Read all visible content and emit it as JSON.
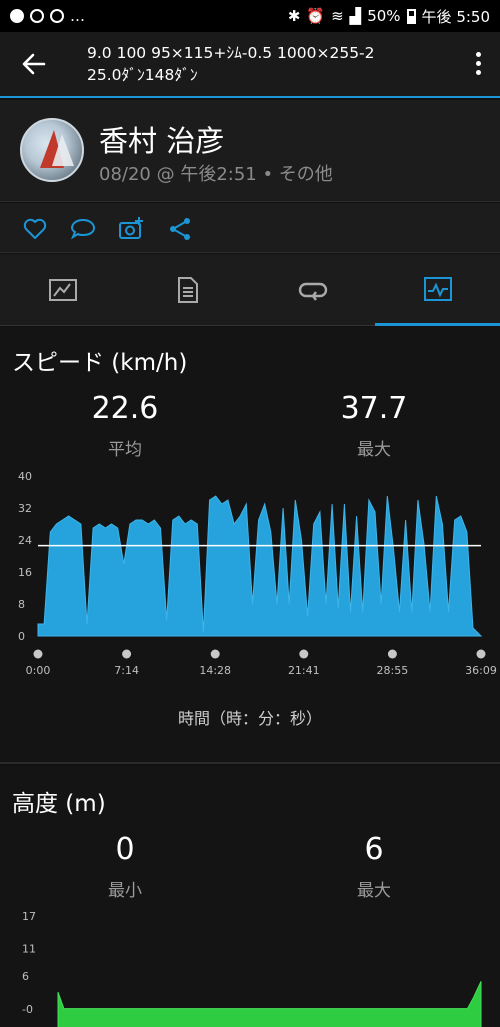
{
  "status_bar": {
    "left_text": "…",
    "battery": "50%",
    "time": "午後 5:50"
  },
  "appbar": {
    "title_line1": "9.0 100 95×115+ｼﾑ-0.5 1000×255-2",
    "title_line2": "25.0ﾀﾞﾝ148ﾀﾞﾝ"
  },
  "profile": {
    "name": "香村 治彦",
    "meta": "08/20 @ 午後2:51 • その他"
  },
  "actions": [
    "like-icon",
    "comment-icon",
    "add-photo-icon",
    "share-icon"
  ],
  "tabs": [
    {
      "name": "overview",
      "icon": "map-summary-icon"
    },
    {
      "name": "details",
      "icon": "document-icon"
    },
    {
      "name": "laps",
      "icon": "laps-icon"
    },
    {
      "name": "charts",
      "icon": "chart-icon",
      "active": true
    }
  ],
  "colors": {
    "accent": "#1b95d6",
    "speed_fill": "#26a3dc",
    "altitude_fill": "#2ecc40"
  },
  "speed": {
    "title": "スピード (km/h)",
    "avg_value": "22.6",
    "avg_label": "平均",
    "max_value": "37.7",
    "max_label": "最大",
    "x_axis_title": "時間（時：分：秒）"
  },
  "altitude": {
    "title": "高度 (m)",
    "min_value": "0",
    "min_label": "最小",
    "max_value": "6",
    "max_label": "最大"
  },
  "chart_data": [
    {
      "type": "area",
      "name": "speed",
      "ylim": [
        0,
        40
      ],
      "yticks": [
        "40",
        "32",
        "24",
        "16",
        "8",
        "0"
      ],
      "xticks": [
        "0:00",
        "7:14",
        "14:28",
        "21:41",
        "28:55",
        "36:09"
      ],
      "average_line": 22.6,
      "x_minutes": [
        0,
        0.5,
        1,
        1.5,
        2,
        2.5,
        3,
        3.5,
        4,
        4.5,
        5,
        5.5,
        6,
        6.5,
        7,
        7.5,
        8,
        8.5,
        9,
        9.5,
        10,
        10.5,
        11,
        11.5,
        12,
        12.5,
        13,
        13.5,
        14,
        14.5,
        15,
        15.5,
        16,
        16.5,
        17,
        17.5,
        18,
        18.5,
        19,
        19.5,
        20,
        20.5,
        21,
        21.5,
        22,
        22.5,
        23,
        23.5,
        24,
        24.5,
        25,
        25.5,
        26,
        26.5,
        27,
        27.5,
        28,
        28.5,
        29,
        29.5,
        30,
        30.5,
        31,
        31.5,
        32,
        32.5,
        33,
        33.5,
        34,
        34.5,
        35,
        35.5,
        36.15
      ],
      "y_kmh": [
        3,
        3,
        26,
        28,
        29,
        30,
        29,
        28,
        3,
        27,
        28,
        27,
        28,
        27,
        18,
        28,
        29,
        29,
        28,
        29,
        27,
        4,
        29,
        30,
        28,
        29,
        28,
        1,
        34,
        35,
        33,
        34,
        28,
        30,
        33,
        8,
        29,
        33,
        26,
        8,
        32,
        8,
        34,
        24,
        5,
        28,
        31,
        8,
        33,
        7,
        33,
        6,
        30,
        6,
        34,
        31,
        8,
        35,
        22,
        6,
        29,
        6,
        34,
        23,
        6,
        35,
        28,
        6,
        29,
        30,
        26,
        2,
        0
      ]
    },
    {
      "type": "area",
      "name": "altitude",
      "ylim": [
        -1,
        17
      ],
      "yticks": [
        "17",
        "11",
        "6",
        "-0"
      ],
      "x_minutes": [
        0,
        0.5,
        1,
        35,
        35.5,
        36.15
      ],
      "y_m": [
        3,
        0,
        0,
        0,
        2,
        5
      ]
    }
  ]
}
